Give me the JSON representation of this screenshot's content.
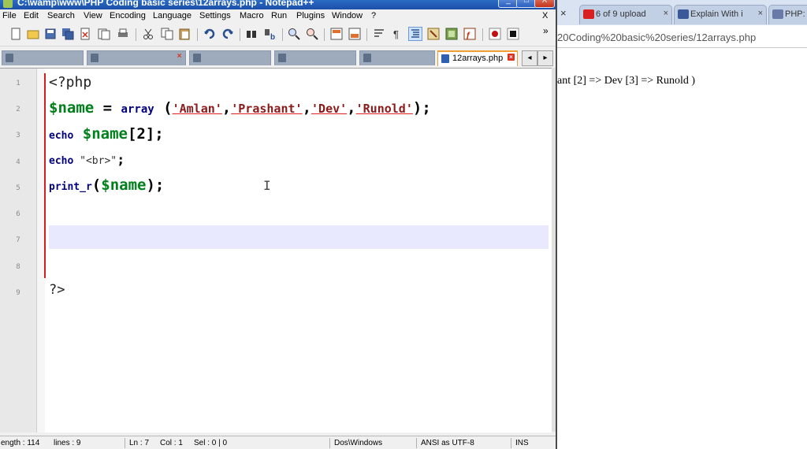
{
  "notepad": {
    "title": "C:\\wamp\\www\\PHP Coding basic series\\12arrays.php - Notepad++",
    "window_buttons": {
      "minimize": "_",
      "maximize": "□",
      "close": "X"
    },
    "menu": [
      "File",
      "Edit",
      "Search",
      "View",
      "Encoding",
      "Language",
      "Settings",
      "Macro",
      "Run",
      "Plugins",
      "Window",
      "?"
    ],
    "menu_close": "X",
    "toolbar_more": "»",
    "tabs": [
      {
        "label": "12arrays.php"
      }
    ],
    "tab_nav": {
      "left": "◂",
      "right": "▸"
    },
    "line_numbers": [
      "1",
      "2",
      "3",
      "4",
      "5",
      "6",
      "7",
      "8",
      "9"
    ],
    "code": {
      "line1": {
        "open": "<?php"
      },
      "line2": {
        "var": "$name",
        "eq": " = ",
        "kw": "array",
        "open": " (",
        "s1": "'Amlan'",
        "s2": "'Prashant'",
        "s3": "'Dev'",
        "s4": "'Runold'",
        "comma": ",",
        "close": ");"
      },
      "line3": {
        "kw": "echo",
        "var": " $name",
        "idx": "[2]",
        "end": ";"
      },
      "line4": {
        "kw": "echo",
        "str": " \"<br>\"",
        "end": ";"
      },
      "line5": {
        "kw": "print_r",
        "open": "(",
        "var": "$name",
        "close": ");"
      },
      "line9": {
        "close": "?>"
      }
    },
    "status": {
      "length": "ength : 114",
      "lines": "lines : 9",
      "ln": "Ln : 7",
      "col": "Col : 1",
      "sel": "Sel : 0 | 0",
      "eol": "Dos\\Windows",
      "encoding": "ANSI as UTF-8",
      "mode": "INS"
    }
  },
  "browser": {
    "tabs": [
      {
        "label": "6 of 9 upload",
        "close": "×",
        "icon": "youtube-icon"
      },
      {
        "label": "Explain With i",
        "close": "×",
        "icon": "facebook-icon"
      },
      {
        "label": "PHP: I",
        "close": "",
        "icon": "php-icon"
      }
    ],
    "first_close": "×",
    "url": "20Coding%20basic%20series/12arrays.php",
    "output": "ant [2] => Dev [3] => Runold )"
  },
  "colors": {
    "keyword": "#000080",
    "variable": "#00801a",
    "string": "#8b1a1a",
    "fold_line": "#d22020",
    "current_line": "#e8e8ff"
  }
}
